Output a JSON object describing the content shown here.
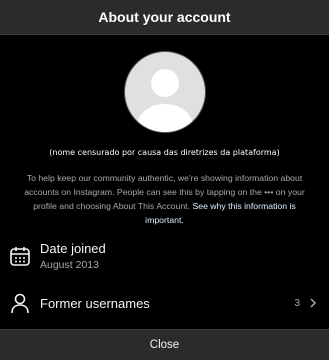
{
  "header": {
    "title": "About your account"
  },
  "profile": {
    "username": "(nome censurado por causa das diretrizes da plataforma)"
  },
  "info": {
    "text": "To help keep our community authentic, we're showing information about accounts on Instagram. People can see this by tapping on the ••• on your profile and choosing About This Account.",
    "link": "See why this information is important."
  },
  "date_joined": {
    "title": "Date joined",
    "value": "August 2013"
  },
  "former_usernames": {
    "title": "Former usernames",
    "count": "3"
  },
  "footer": {
    "close_label": "Close"
  },
  "icons": {
    "calendar": "calendar-icon",
    "person": "person-icon",
    "chevron": "chevron-right-icon"
  }
}
